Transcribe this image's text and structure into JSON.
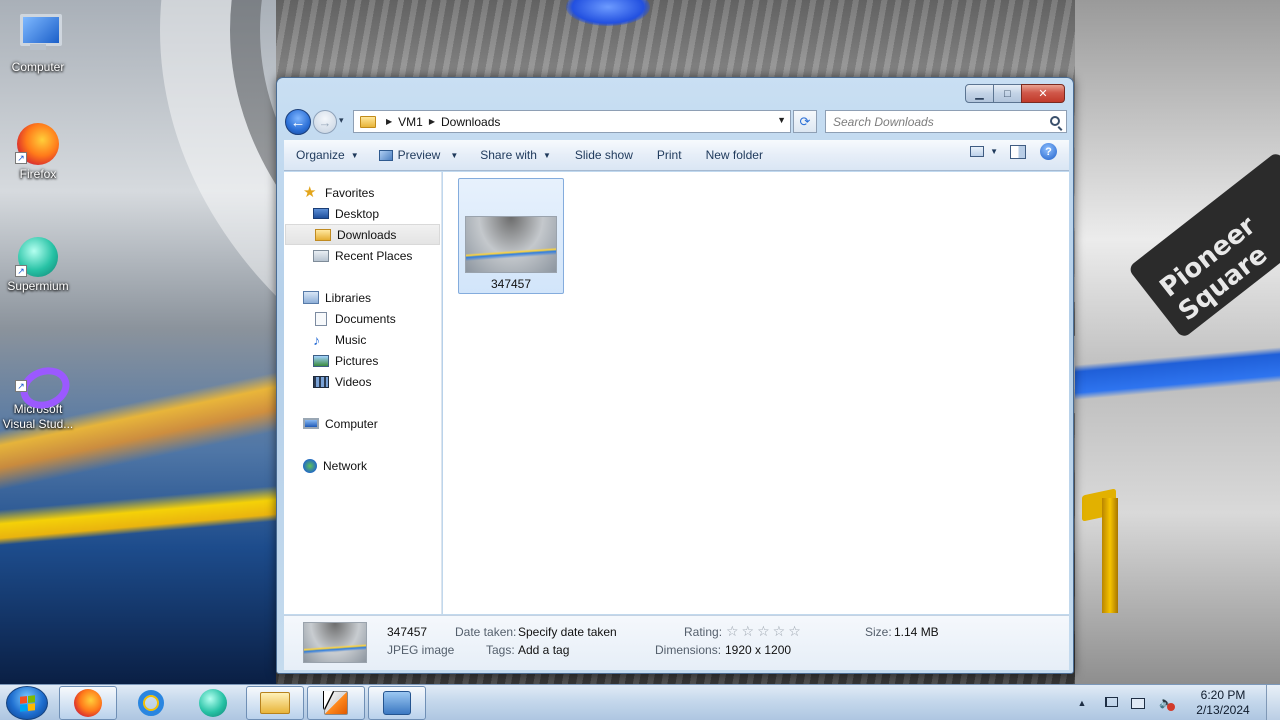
{
  "desktop": {
    "icons": [
      {
        "label": "Computer"
      },
      {
        "label": "Firefox"
      },
      {
        "label": "Supermium"
      },
      {
        "label": "Microsoft Visual Stud..."
      }
    ],
    "wallpaper_sign": "Pioneer Square"
  },
  "window": {
    "caption": {
      "minimize": "▁",
      "maximize": "□",
      "close": "✕"
    },
    "nav": {
      "back": "←",
      "forward": "→",
      "history_caret": "▾"
    },
    "address": {
      "crumbs": [
        "VM1",
        "Downloads"
      ],
      "separator": "▶",
      "dropdown": "▼",
      "refresh": "⟳"
    },
    "search": {
      "placeholder": "Search Downloads"
    },
    "commands": {
      "organize": "Organize",
      "preview": "Preview",
      "share_with": "Share with",
      "slide_show": "Slide show",
      "print": "Print",
      "new_folder": "New folder",
      "caret": "▼",
      "help": "?"
    },
    "nav_pane": {
      "favorites": "Favorites",
      "desktop": "Desktop",
      "downloads": "Downloads",
      "recent_places": "Recent Places",
      "libraries": "Libraries",
      "documents": "Documents",
      "music": "Music",
      "pictures": "Pictures",
      "videos": "Videos",
      "computer": "Computer",
      "network": "Network"
    },
    "files": [
      {
        "name": "347457",
        "selected": true
      }
    ],
    "details": {
      "name": "347457",
      "type": "JPEG image",
      "date_taken_label": "Date taken:",
      "date_taken_value": "Specify date taken",
      "tags_label": "Tags:",
      "tags_value": "Add a tag",
      "rating_label": "Rating:",
      "rating_stars": "☆☆☆☆☆",
      "dimensions_label": "Dimensions:",
      "dimensions_value": "1920 x 1200",
      "size_label": "Size:",
      "size_value": "1.14 MB"
    }
  },
  "taskbar": {
    "tray_arrow": "▲",
    "time": "6:20 PM",
    "date": "2/13/2024"
  },
  "colors": {
    "accent": "#2b6fd6",
    "window_frame": "#b4cfe9",
    "close_button": "#c13a2a",
    "selection": "#d2e5fa"
  }
}
